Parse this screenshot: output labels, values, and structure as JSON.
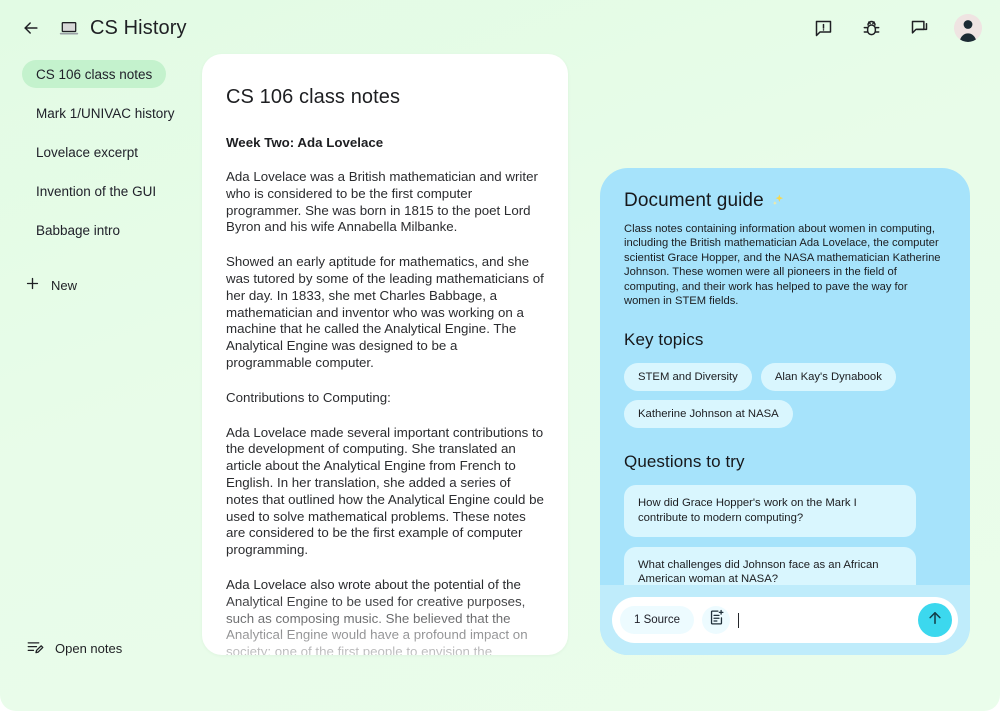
{
  "topbar": {
    "back_icon": "arrow-left-icon",
    "app_icon": "laptop-icon",
    "title": "CS History",
    "actions": [
      {
        "name": "feedback-icon",
        "label": "Send feedback"
      },
      {
        "name": "bug-icon",
        "label": "Report a bug"
      },
      {
        "name": "chat-icon",
        "label": "Chat"
      }
    ],
    "avatar_label": "Account"
  },
  "sidebar": {
    "items": [
      {
        "label": "CS 106 class notes",
        "active": true
      },
      {
        "label": "Mark 1/UNIVAC history",
        "active": false
      },
      {
        "label": "Lovelace excerpt",
        "active": false
      },
      {
        "label": "Invention of the GUI",
        "active": false
      },
      {
        "label": "Babbage intro",
        "active": false
      }
    ],
    "new_label": "New",
    "new_icon": "plus-icon",
    "open_notes_label": "Open notes",
    "open_notes_icon": "edit-note-icon"
  },
  "document": {
    "title": "CS 106 class notes",
    "subtitle": "Week Two: Ada Lovelace",
    "paragraphs": [
      "Ada Lovelace was a British mathematician and writer who is considered to be the first computer programmer. She was born in 1815 to the poet Lord Byron and his wife Annabella Milbanke.",
      "Showed an early aptitude for mathematics, and she was tutored by some of the leading mathematicians of her day. In 1833, she met Charles Babbage, a mathematician and inventor who was working on a machine that he called the Analytical Engine. The Analytical Engine was designed to be a programmable computer.",
      "Contributions to Computing:",
      "Ada Lovelace made several important contributions to the development of computing. She translated an article about the Analytical Engine from French to English. In her translation, she added a series of notes that outlined how the Analytical Engine could be used to solve mathematical problems. These notes are considered to be the first example of computer programming.",
      "Ada Lovelace also wrote about the potential of the Analytical Engine to be used for creative purposes, such as composing music. She believed that the Analytical Engine would have a profound impact on society; one of the first people to envision the potential of computers to be used for more than just calculation."
    ]
  },
  "guide": {
    "title": "Document guide",
    "title_icon": "sparkle-icon",
    "description": "Class notes containing information about women in computing, including the British mathematician Ada Lovelace, the computer scientist Grace Hopper, and the NASA mathematician Katherine Johnson. These women were all pioneers in the field of computing, and their work has helped to pave the way for women in STEM fields.",
    "key_topics_heading": "Key topics",
    "key_topics": [
      "STEM and Diversity",
      "Alan Kay's Dynabook",
      "Katherine Johnson at NASA"
    ],
    "questions_heading": "Questions to try",
    "questions": [
      "How did Grace Hopper's work on the Mark I contribute to modern computing?",
      "What challenges did Johnson face as an African American woman at NASA?"
    ]
  },
  "composer": {
    "source_chip_label": "1 Source",
    "add_note_icon": "add-note-icon",
    "input_value": "",
    "input_placeholder": "",
    "send_icon": "arrow-up-icon"
  },
  "colors": {
    "page_background": "#e6fbe8",
    "guide_panel": "#a6e3fb",
    "guide_chip": "#d9f6fe",
    "composer_bar": "#bfecfb",
    "send_button": "#3cd8ee",
    "sidebar_active": "#c4f2cd",
    "card_background": "#ffffff",
    "text_primary": "#1d1e21"
  }
}
